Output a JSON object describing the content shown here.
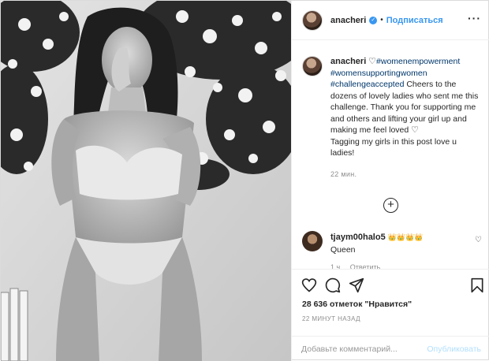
{
  "header": {
    "username": "anacheri",
    "separator": "•",
    "follow_label": "Подписаться",
    "more_label": "···"
  },
  "caption": {
    "username": "anacheri",
    "heart": "♡",
    "hashtags": [
      "#womenempowerment",
      "#womensupportingwomen",
      "#challengeaccepted"
    ],
    "text": "Cheers to the dozens of lovely ladies who sent me this challenge. Thank you for supporting me and others and lifting your girl up and making me feel loved",
    "heart2": "♡",
    "text2": "Tagging my girls in this post love u ladies!",
    "time": "22 мин."
  },
  "load_more": "+",
  "comment": {
    "username": "tjaym00halo5",
    "crowns": "👑👑👑👑",
    "text": "Queen",
    "likes": "1 ч",
    "reply_label": "Ответить",
    "heart": "♡"
  },
  "actions": {
    "like_icon": "heart-icon",
    "comment_icon": "comment-icon",
    "share_icon": "share-icon",
    "save_icon": "bookmark-icon"
  },
  "likes_text": "28 636 отметок \"Нравится\"",
  "posted_ago": "22 МИНУТ НАЗАД",
  "add_comment": {
    "placeholder": "Добавьте комментарий...",
    "publish_label": "Опубликовать"
  },
  "colors": {
    "accent": "#3897f0",
    "publish_disabled": "#b2dffc",
    "muted": "#8e8e8e",
    "text": "#262626"
  }
}
